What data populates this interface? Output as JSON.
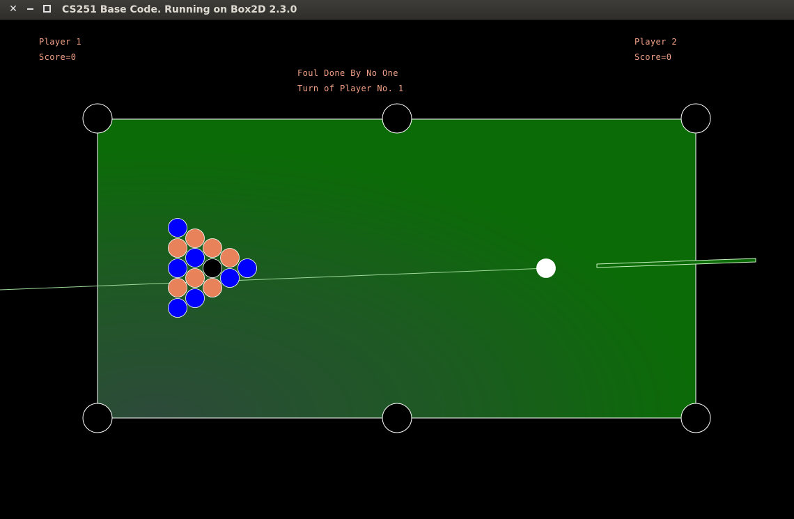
{
  "window": {
    "title": "CS251 Base Code. Running on Box2D 2.3.0",
    "close_icon": "close-icon",
    "minimize_icon": "minimize-icon",
    "maximize_icon": "maximize-icon"
  },
  "hud": {
    "player1": {
      "name": "Player 1",
      "score": "Score=0"
    },
    "player2": {
      "name": "Player 2",
      "score": "Score=0"
    },
    "foul": "Foul Done By No One",
    "turn": "Turn of Player No. 1"
  },
  "colors": {
    "felt": "#0b6b07",
    "felt_shade": "#2a4a36",
    "table_border": "#ffffff",
    "pocket": "#000000",
    "pocket_outline": "#ffffff",
    "ball_blue": "#0000ff",
    "ball_orange": "#e8825a",
    "ball_black": "#000000",
    "cue_ball": "#ffffff",
    "aim_line": "#9fd99a",
    "cue_stick": "#0b6b07",
    "hud_text": "#f2a186"
  },
  "balls": [
    {
      "kind": "blue",
      "color": "#0000ff"
    },
    {
      "kind": "orange",
      "color": "#e8825a"
    },
    {
      "kind": "blue",
      "color": "#0000ff"
    },
    {
      "kind": "orange",
      "color": "#e8825a"
    },
    {
      "kind": "orange",
      "color": "#e8825a"
    },
    {
      "kind": "blue",
      "color": "#0000ff"
    },
    {
      "kind": "black",
      "color": "#000000"
    },
    {
      "kind": "orange",
      "color": "#e8825a"
    },
    {
      "kind": "orange",
      "color": "#e8825a"
    },
    {
      "kind": "blue",
      "color": "#0000ff"
    },
    {
      "kind": "orange",
      "color": "#e8825a"
    },
    {
      "kind": "blue",
      "color": "#0000ff"
    },
    {
      "kind": "orange",
      "color": "#e8825a"
    },
    {
      "kind": "blue",
      "color": "#0000ff"
    },
    {
      "kind": "blue",
      "color": "#0000ff"
    }
  ]
}
